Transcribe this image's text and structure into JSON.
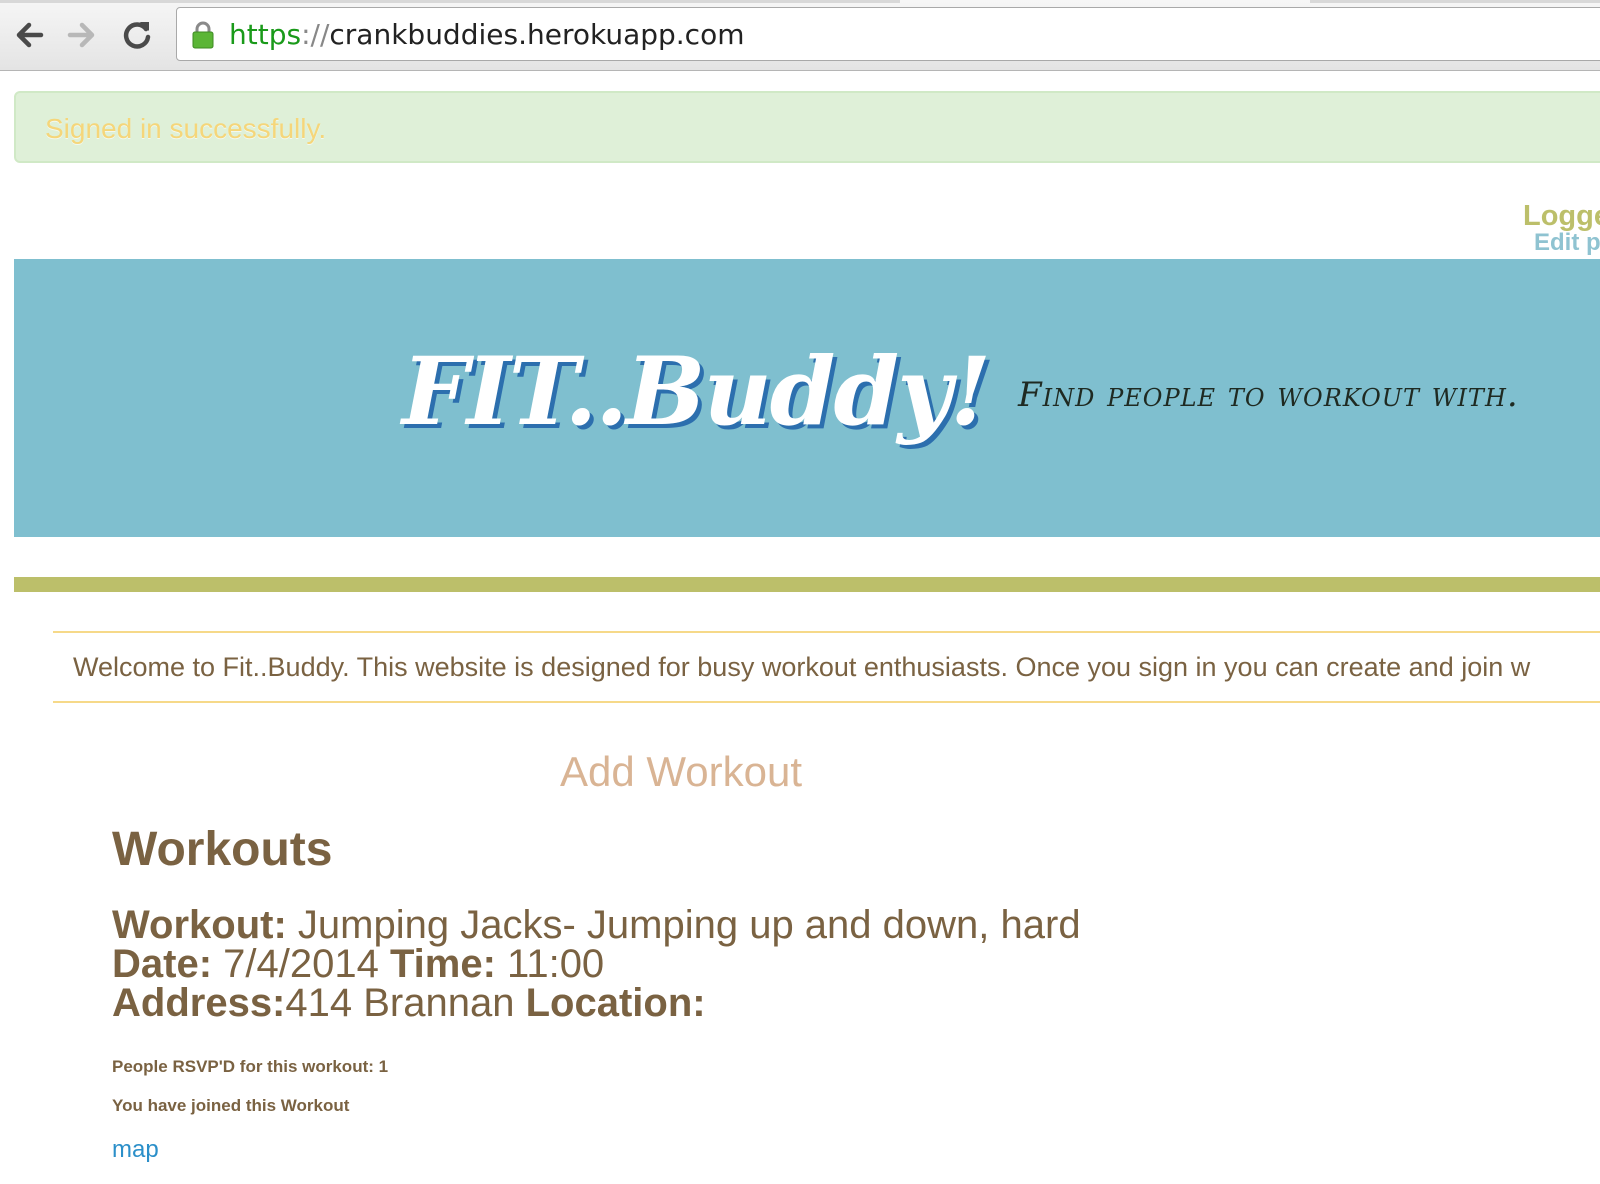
{
  "browser": {
    "url_scheme": "https",
    "url_separator": "://",
    "url_host": "crankbuddies.herokuapp.com",
    "back_icon": "back-arrow-icon",
    "forward_icon": "forward-arrow-icon",
    "reload_icon": "reload-icon",
    "lock_icon": "lock-icon"
  },
  "flash": {
    "message": "Signed in successfully."
  },
  "user_nav": {
    "logged_label": "Logge",
    "edit_profile_label": "Edit pr"
  },
  "header": {
    "logo": "FIT..Buddy!",
    "tagline": "Find people to workout with."
  },
  "welcome": {
    "text": "Welcome to Fit..Buddy. This website is designed for busy workout enthusiasts. Once you sign in you can create and join w"
  },
  "main": {
    "add_workout_label": "Add Workout",
    "title": "Workouts",
    "workout": {
      "workout_label": "Workout:",
      "workout_value": " Jumping Jacks- Jumping up and down, hard",
      "date_label": "Date:",
      "date_value": " 7/4/2014 ",
      "time_label": "Time:",
      "time_value": " 11:00",
      "address_label": "Address:",
      "address_value": "414 Brannan ",
      "location_label": "Location:",
      "rsvp_text": "People RSVP'D for this workout: 1",
      "joined_text": "You have joined this Workout",
      "map_link": "map"
    }
  },
  "colors": {
    "hero_bg": "#7fbfcf",
    "accent_bar": "#bcbf6a",
    "text_brown": "#7a6242",
    "link_blue": "#2b8fc9",
    "flash_bg": "#dff0d8"
  }
}
